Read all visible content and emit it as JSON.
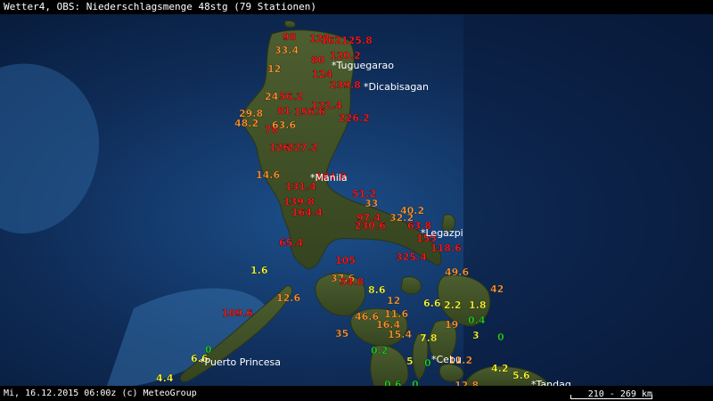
{
  "header": {
    "title": "Wetter4, OBS: Niederschlagsmenge 48stg (79 Stationen)"
  },
  "footer": {
    "timestamp": "Mi, 16.12.2015 06:00z (c) MeteoGroup",
    "scale": "210 - 269 km"
  },
  "colors": {
    "red": "#ff1a1a",
    "orange": "#ff9933",
    "yellow": "#ffff33",
    "green": "#22cc22"
  },
  "cities": [
    {
      "name": "*Tuguegarao"
    },
    {
      "name": "*Dicabisagan"
    },
    {
      "name": "*Manila"
    },
    {
      "name": "*Legazpi"
    },
    {
      "name": "*Cebu"
    },
    {
      "name": "*Puerto Princesa"
    },
    {
      "name": "*Tandag"
    }
  ],
  "stations": [
    {
      "v": "98",
      "c": "red"
    },
    {
      "v": "127",
      "c": "red"
    },
    {
      "v": "162",
      "c": "red"
    },
    {
      "v": "125.8",
      "c": "red"
    },
    {
      "v": "33.4",
      "c": "orange"
    },
    {
      "v": "120.2",
      "c": "red"
    },
    {
      "v": "80",
      "c": "red"
    },
    {
      "v": "12",
      "c": "orange"
    },
    {
      "v": "124",
      "c": "red"
    },
    {
      "v": "239.8",
      "c": "red"
    },
    {
      "v": "24",
      "c": "orange"
    },
    {
      "v": "56.2",
      "c": "red"
    },
    {
      "v": "122.4",
      "c": "red"
    },
    {
      "v": "29.8",
      "c": "orange"
    },
    {
      "v": "81",
      "c": "red"
    },
    {
      "v": "156.6",
      "c": "red"
    },
    {
      "v": "226.2",
      "c": "red"
    },
    {
      "v": "48.2",
      "c": "orange"
    },
    {
      "v": "78",
      "c": "red"
    },
    {
      "v": "63.6",
      "c": "orange"
    },
    {
      "v": "126",
      "c": "red"
    },
    {
      "v": "227.2",
      "c": "red"
    },
    {
      "v": "14.6",
      "c": "orange"
    },
    {
      "v": "104.8",
      "c": "red"
    },
    {
      "v": "131.4",
      "c": "red"
    },
    {
      "v": "51.2",
      "c": "red"
    },
    {
      "v": "33",
      "c": "orange"
    },
    {
      "v": "139.8",
      "c": "red"
    },
    {
      "v": "40.2",
      "c": "orange"
    },
    {
      "v": "164.4",
      "c": "red"
    },
    {
      "v": "97.4",
      "c": "red"
    },
    {
      "v": "32.2",
      "c": "orange"
    },
    {
      "v": "230.6",
      "c": "red"
    },
    {
      "v": "63.8",
      "c": "red"
    },
    {
      "v": "65.4",
      "c": "red"
    },
    {
      "v": "155",
      "c": "red"
    },
    {
      "v": "118.6",
      "c": "red"
    },
    {
      "v": "105",
      "c": "red"
    },
    {
      "v": "325.4",
      "c": "red"
    },
    {
      "v": "1.6",
      "c": "yellow"
    },
    {
      "v": "49.6",
      "c": "orange"
    },
    {
      "v": "37.6",
      "c": "orange"
    },
    {
      "v": "54.8",
      "c": "red"
    },
    {
      "v": "8.6",
      "c": "yellow"
    },
    {
      "v": "42",
      "c": "orange"
    },
    {
      "v": "12.6",
      "c": "orange"
    },
    {
      "v": "12",
      "c": "orange"
    },
    {
      "v": "6.6",
      "c": "yellow"
    },
    {
      "v": "2.2",
      "c": "yellow"
    },
    {
      "v": "1.8",
      "c": "yellow"
    },
    {
      "v": "109.6",
      "c": "red"
    },
    {
      "v": "46.6",
      "c": "orange"
    },
    {
      "v": "11.6",
      "c": "orange"
    },
    {
      "v": "0.4",
      "c": "green"
    },
    {
      "v": "16.4",
      "c": "orange"
    },
    {
      "v": "19",
      "c": "orange"
    },
    {
      "v": "35",
      "c": "orange"
    },
    {
      "v": "15.4",
      "c": "orange"
    },
    {
      "v": "7.8",
      "c": "yellow"
    },
    {
      "v": "3",
      "c": "yellow"
    },
    {
      "v": "0",
      "c": "green"
    },
    {
      "v": "0",
      "c": "green"
    },
    {
      "v": "0.2",
      "c": "green"
    },
    {
      "v": "6.6",
      "c": "yellow"
    },
    {
      "v": "5",
      "c": "yellow"
    },
    {
      "v": "0",
      "c": "green"
    },
    {
      "v": "11.2",
      "c": "orange"
    },
    {
      "v": "4.4",
      "c": "yellow"
    },
    {
      "v": "4.2",
      "c": "yellow"
    },
    {
      "v": "5.6",
      "c": "yellow"
    },
    {
      "v": "0.6",
      "c": "green"
    },
    {
      "v": "0",
      "c": "green"
    },
    {
      "v": "12.8",
      "c": "orange"
    }
  ]
}
